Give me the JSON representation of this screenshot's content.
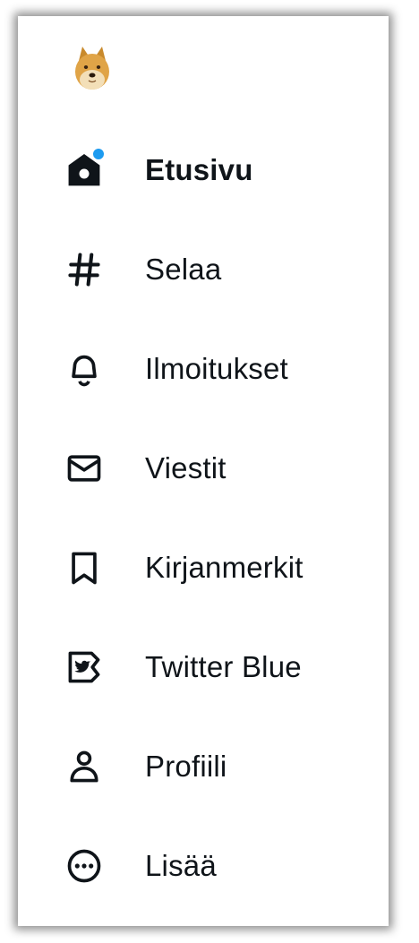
{
  "colors": {
    "text": "#0f1419",
    "accent": "#1d9bf0"
  },
  "logo": {
    "icon": "doge-logo-icon"
  },
  "nav": {
    "items": [
      {
        "label": "Etusivu",
        "icon": "home-icon",
        "active": true,
        "notification_dot": true
      },
      {
        "label": "Selaa",
        "icon": "hashtag-icon"
      },
      {
        "label": "Ilmoitukset",
        "icon": "bell-icon"
      },
      {
        "label": "Viestit",
        "icon": "envelope-icon"
      },
      {
        "label": "Kirjanmerkit",
        "icon": "bookmark-icon"
      },
      {
        "label": "Twitter Blue",
        "icon": "twitter-blue-icon"
      },
      {
        "label": "Profiili",
        "icon": "person-icon"
      },
      {
        "label": "Lisää",
        "icon": "more-circle-icon"
      }
    ]
  }
}
